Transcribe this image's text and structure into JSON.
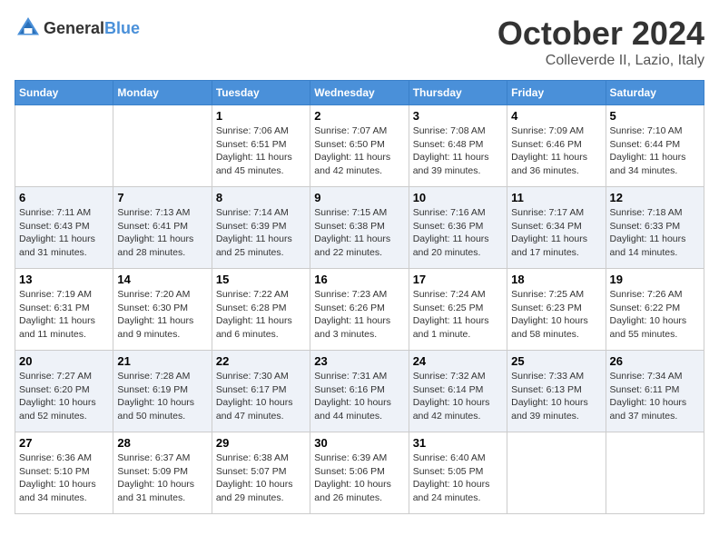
{
  "header": {
    "logo": {
      "text_general": "General",
      "text_blue": "Blue",
      "icon": "▶"
    },
    "month": "October 2024",
    "location": "Colleverde II, Lazio, Italy"
  },
  "days_of_week": [
    "Sunday",
    "Monday",
    "Tuesday",
    "Wednesday",
    "Thursday",
    "Friday",
    "Saturday"
  ],
  "weeks": [
    {
      "days": [
        {
          "num": "",
          "info": ""
        },
        {
          "num": "",
          "info": ""
        },
        {
          "num": "1",
          "info": "Sunrise: 7:06 AM\nSunset: 6:51 PM\nDaylight: 11 hours and 45 minutes."
        },
        {
          "num": "2",
          "info": "Sunrise: 7:07 AM\nSunset: 6:50 PM\nDaylight: 11 hours and 42 minutes."
        },
        {
          "num": "3",
          "info": "Sunrise: 7:08 AM\nSunset: 6:48 PM\nDaylight: 11 hours and 39 minutes."
        },
        {
          "num": "4",
          "info": "Sunrise: 7:09 AM\nSunset: 6:46 PM\nDaylight: 11 hours and 36 minutes."
        },
        {
          "num": "5",
          "info": "Sunrise: 7:10 AM\nSunset: 6:44 PM\nDaylight: 11 hours and 34 minutes."
        }
      ]
    },
    {
      "days": [
        {
          "num": "6",
          "info": "Sunrise: 7:11 AM\nSunset: 6:43 PM\nDaylight: 11 hours and 31 minutes."
        },
        {
          "num": "7",
          "info": "Sunrise: 7:13 AM\nSunset: 6:41 PM\nDaylight: 11 hours and 28 minutes."
        },
        {
          "num": "8",
          "info": "Sunrise: 7:14 AM\nSunset: 6:39 PM\nDaylight: 11 hours and 25 minutes."
        },
        {
          "num": "9",
          "info": "Sunrise: 7:15 AM\nSunset: 6:38 PM\nDaylight: 11 hours and 22 minutes."
        },
        {
          "num": "10",
          "info": "Sunrise: 7:16 AM\nSunset: 6:36 PM\nDaylight: 11 hours and 20 minutes."
        },
        {
          "num": "11",
          "info": "Sunrise: 7:17 AM\nSunset: 6:34 PM\nDaylight: 11 hours and 17 minutes."
        },
        {
          "num": "12",
          "info": "Sunrise: 7:18 AM\nSunset: 6:33 PM\nDaylight: 11 hours and 14 minutes."
        }
      ]
    },
    {
      "days": [
        {
          "num": "13",
          "info": "Sunrise: 7:19 AM\nSunset: 6:31 PM\nDaylight: 11 hours and 11 minutes."
        },
        {
          "num": "14",
          "info": "Sunrise: 7:20 AM\nSunset: 6:30 PM\nDaylight: 11 hours and 9 minutes."
        },
        {
          "num": "15",
          "info": "Sunrise: 7:22 AM\nSunset: 6:28 PM\nDaylight: 11 hours and 6 minutes."
        },
        {
          "num": "16",
          "info": "Sunrise: 7:23 AM\nSunset: 6:26 PM\nDaylight: 11 hours and 3 minutes."
        },
        {
          "num": "17",
          "info": "Sunrise: 7:24 AM\nSunset: 6:25 PM\nDaylight: 11 hours and 1 minute."
        },
        {
          "num": "18",
          "info": "Sunrise: 7:25 AM\nSunset: 6:23 PM\nDaylight: 10 hours and 58 minutes."
        },
        {
          "num": "19",
          "info": "Sunrise: 7:26 AM\nSunset: 6:22 PM\nDaylight: 10 hours and 55 minutes."
        }
      ]
    },
    {
      "days": [
        {
          "num": "20",
          "info": "Sunrise: 7:27 AM\nSunset: 6:20 PM\nDaylight: 10 hours and 52 minutes."
        },
        {
          "num": "21",
          "info": "Sunrise: 7:28 AM\nSunset: 6:19 PM\nDaylight: 10 hours and 50 minutes."
        },
        {
          "num": "22",
          "info": "Sunrise: 7:30 AM\nSunset: 6:17 PM\nDaylight: 10 hours and 47 minutes."
        },
        {
          "num": "23",
          "info": "Sunrise: 7:31 AM\nSunset: 6:16 PM\nDaylight: 10 hours and 44 minutes."
        },
        {
          "num": "24",
          "info": "Sunrise: 7:32 AM\nSunset: 6:14 PM\nDaylight: 10 hours and 42 minutes."
        },
        {
          "num": "25",
          "info": "Sunrise: 7:33 AM\nSunset: 6:13 PM\nDaylight: 10 hours and 39 minutes."
        },
        {
          "num": "26",
          "info": "Sunrise: 7:34 AM\nSunset: 6:11 PM\nDaylight: 10 hours and 37 minutes."
        }
      ]
    },
    {
      "days": [
        {
          "num": "27",
          "info": "Sunrise: 6:36 AM\nSunset: 5:10 PM\nDaylight: 10 hours and 34 minutes."
        },
        {
          "num": "28",
          "info": "Sunrise: 6:37 AM\nSunset: 5:09 PM\nDaylight: 10 hours and 31 minutes."
        },
        {
          "num": "29",
          "info": "Sunrise: 6:38 AM\nSunset: 5:07 PM\nDaylight: 10 hours and 29 minutes."
        },
        {
          "num": "30",
          "info": "Sunrise: 6:39 AM\nSunset: 5:06 PM\nDaylight: 10 hours and 26 minutes."
        },
        {
          "num": "31",
          "info": "Sunrise: 6:40 AM\nSunset: 5:05 PM\nDaylight: 10 hours and 24 minutes."
        },
        {
          "num": "",
          "info": ""
        },
        {
          "num": "",
          "info": ""
        }
      ]
    }
  ]
}
